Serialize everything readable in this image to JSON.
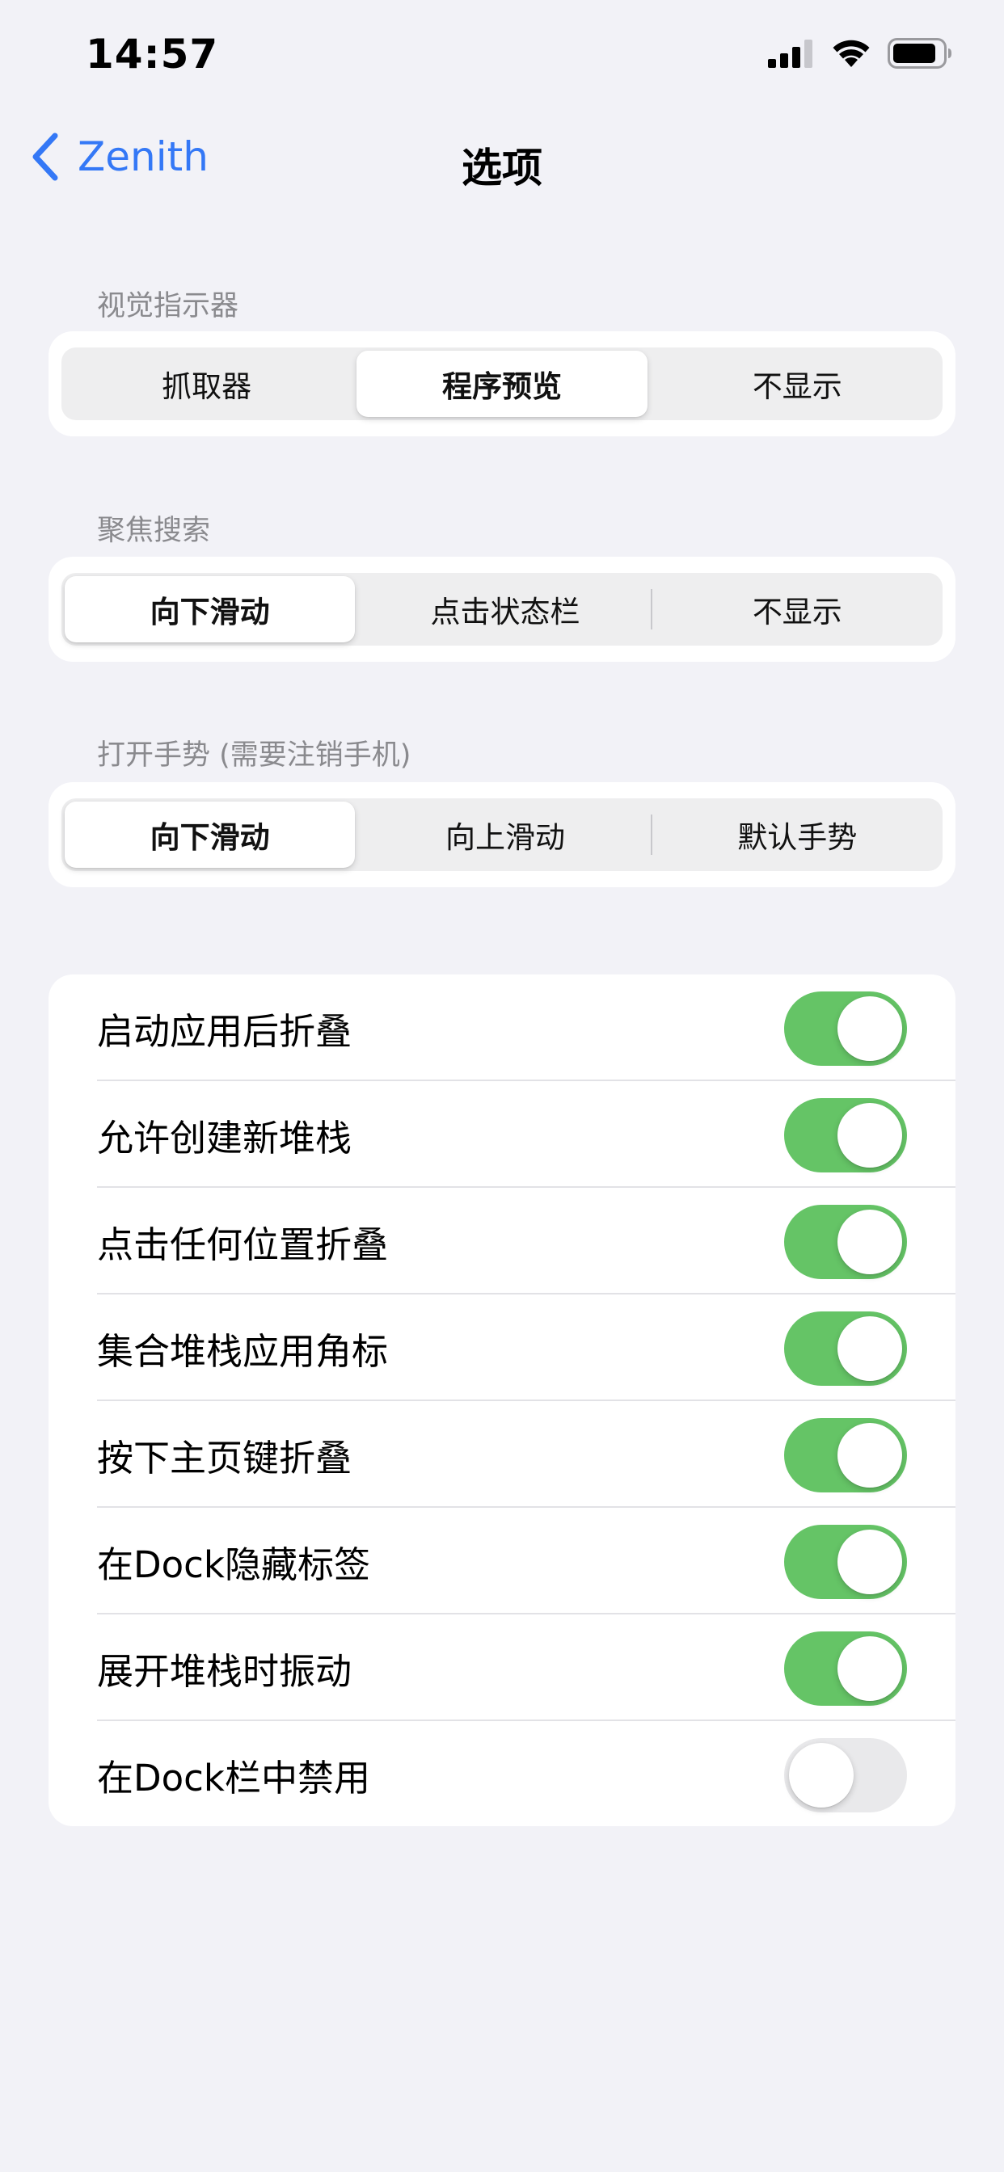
{
  "status_bar": {
    "time": "14:57",
    "signal_icon": "cellular-signal-icon",
    "wifi_icon": "wifi-icon",
    "battery_icon": "battery-icon"
  },
  "nav": {
    "back_label": "Zenith",
    "back_icon": "chevron-left-icon",
    "title": "选项",
    "accent_color": "#3478f6"
  },
  "sections": [
    {
      "header": "视觉指示器",
      "options": [
        "抓取器",
        "程序预览",
        "不显示"
      ],
      "selected_index": 1
    },
    {
      "header": "聚焦搜索",
      "options": [
        "向下滑动",
        "点击状态栏",
        "不显示"
      ],
      "selected_index": 0
    },
    {
      "header": "打开手势 (需要注销手机)",
      "options": [
        "向下滑动",
        "向上滑动",
        "默认手势"
      ],
      "selected_index": 0
    }
  ],
  "toggles": [
    {
      "label": "启动应用后折叠",
      "on": true
    },
    {
      "label": "允许创建新堆栈",
      "on": true
    },
    {
      "label": "点击任何位置折叠",
      "on": true
    },
    {
      "label": "集合堆栈应用角标",
      "on": true
    },
    {
      "label": "按下主页键折叠",
      "on": true
    },
    {
      "label": "在Dock隐藏标签",
      "on": true
    },
    {
      "label": "展开堆栈时振动",
      "on": true
    },
    {
      "label": "在Dock栏中禁用",
      "on": false
    }
  ],
  "colors": {
    "toggle_on": "#65c466",
    "toggle_off": "#e9e9eb",
    "background": "#f2f2f7"
  }
}
